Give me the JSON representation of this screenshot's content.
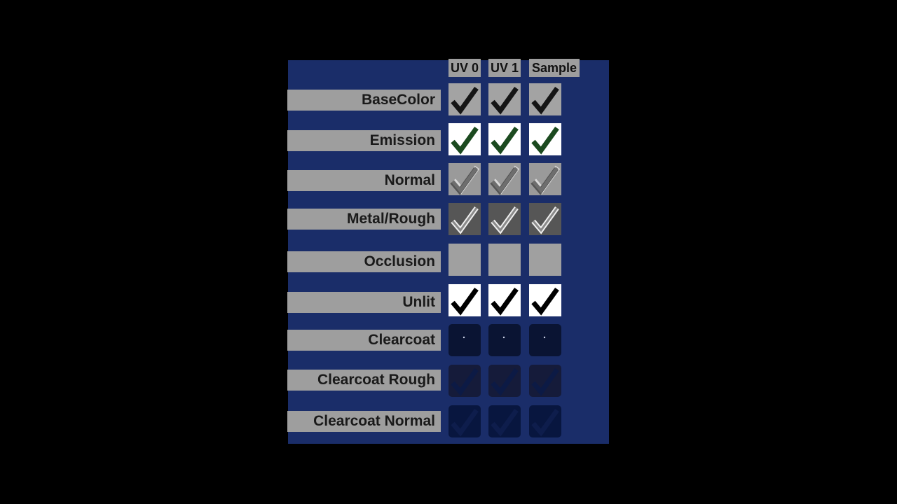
{
  "columns": [
    "UV 0",
    "UV 1",
    "Sample"
  ],
  "rows": [
    {
      "label": "BaseColor",
      "cell_bg": "#a3a3a3",
      "check": "#151515",
      "style": "solid"
    },
    {
      "label": "Emission",
      "cell_bg": "#ffffff",
      "check": "#1b4a1f",
      "style": "solid"
    },
    {
      "label": "Normal",
      "cell_bg": "#9a9a9a",
      "check": "#6e6e6e",
      "style": "embossed"
    },
    {
      "label": "Metal/Rough",
      "cell_bg": "#565656",
      "check": "#c9c9c9",
      "style": "outlined"
    },
    {
      "label": "Occlusion",
      "cell_bg": "#a0a0a0",
      "check": "none",
      "style": "empty"
    },
    {
      "label": "Unlit",
      "cell_bg": "#ffffff",
      "check": "#000000",
      "style": "solid"
    },
    {
      "label": "Clearcoat",
      "cell_bg": "#0a1433",
      "check": "none",
      "style": "dot"
    },
    {
      "label": "Clearcoat Rough",
      "cell_bg": "#151b3a",
      "check": "#0c1a45",
      "style": "faint"
    },
    {
      "label": "Clearcoat Normal",
      "cell_bg": "#08163f",
      "check": "#0e1d4c",
      "style": "faint"
    }
  ],
  "colors": {
    "background": "#000000",
    "panel": "#1a2d69",
    "label_bg": "#9e9e9e",
    "label_text": "#1a1a1a"
  },
  "icons": [
    "checkmark-icon"
  ]
}
